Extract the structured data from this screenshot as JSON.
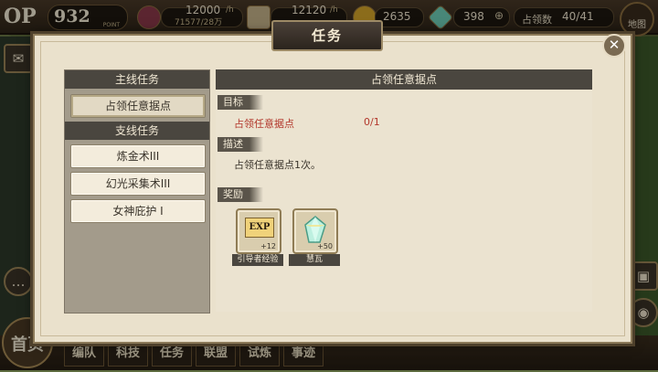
{
  "topbar": {
    "level": "OP",
    "points_value": "932",
    "points_unit": "POINT",
    "resource1_value": "12000",
    "resource1_rate": "/h",
    "resource1_sub": "71577/28万",
    "resource2_value": "12120",
    "resource2_rate": "/h",
    "coins": "2635",
    "gems": "398",
    "territory_label": "占领数",
    "territory_value": "40/41",
    "map_label": "地图"
  },
  "dialog": {
    "title": "任务",
    "close_glyph": "✕"
  },
  "left_panel": {
    "main_header": "主线任务",
    "main_tasks": [
      "占领任意据点"
    ],
    "side_header": "支线任务",
    "side_tasks": [
      "炼金术III",
      "幻光采集术III",
      "女神庇护 I"
    ]
  },
  "detail": {
    "title": "占领任意据点",
    "goal_label": "目标",
    "goal_text": "占领任意据点",
    "goal_progress": "0/1",
    "desc_label": "描述",
    "desc_text": "占领任意据点1次。",
    "reward_label": "奖励",
    "rewards": [
      {
        "icon": "EXP",
        "qty": "+12",
        "name": "引导者经验"
      },
      {
        "icon": "gem-icon",
        "qty": "+50",
        "name": "慧瓦"
      }
    ]
  },
  "bottom_nav": {
    "home": "首页",
    "tabs": [
      "编队",
      "科技",
      "任务",
      "联盟",
      "试炼",
      "事迹"
    ]
  },
  "colors": {
    "accent_red": "#b2372b",
    "header_dark": "#4a463f",
    "panel_bg": "#ebe3d0"
  }
}
